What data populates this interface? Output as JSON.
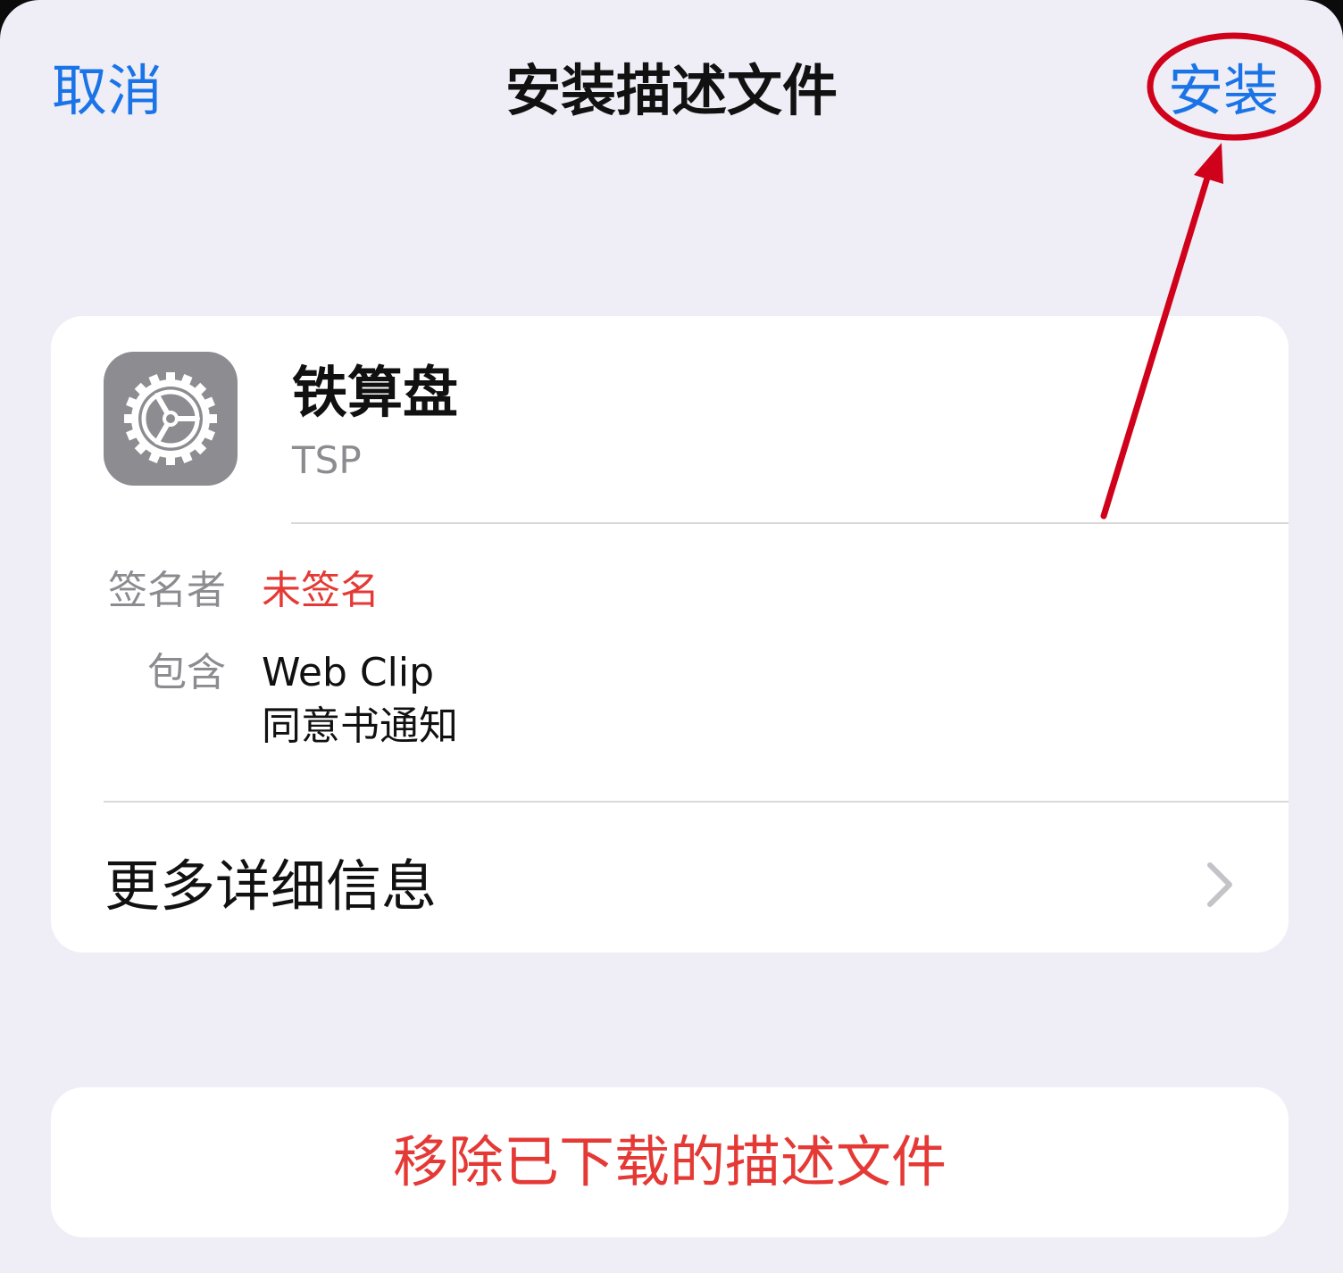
{
  "nav": {
    "cancel_label": "取消",
    "title": "安装描述文件",
    "install_label": "安装"
  },
  "profile": {
    "icon": "gear-icon",
    "name": "铁算盘",
    "organization": "TSP"
  },
  "details": {
    "signer_label": "签名者",
    "signer_value": "未签名",
    "contains_label": "包含",
    "contains_items": [
      "Web Clip",
      "同意书通知"
    ]
  },
  "more": {
    "label": "更多详细信息",
    "icon": "chevron-right-icon"
  },
  "remove": {
    "label": "移除已下载的描述文件"
  },
  "colors": {
    "accent": "#1a74e8",
    "danger": "#e53935",
    "background": "#efeef6",
    "annotation": "#d0021b"
  }
}
